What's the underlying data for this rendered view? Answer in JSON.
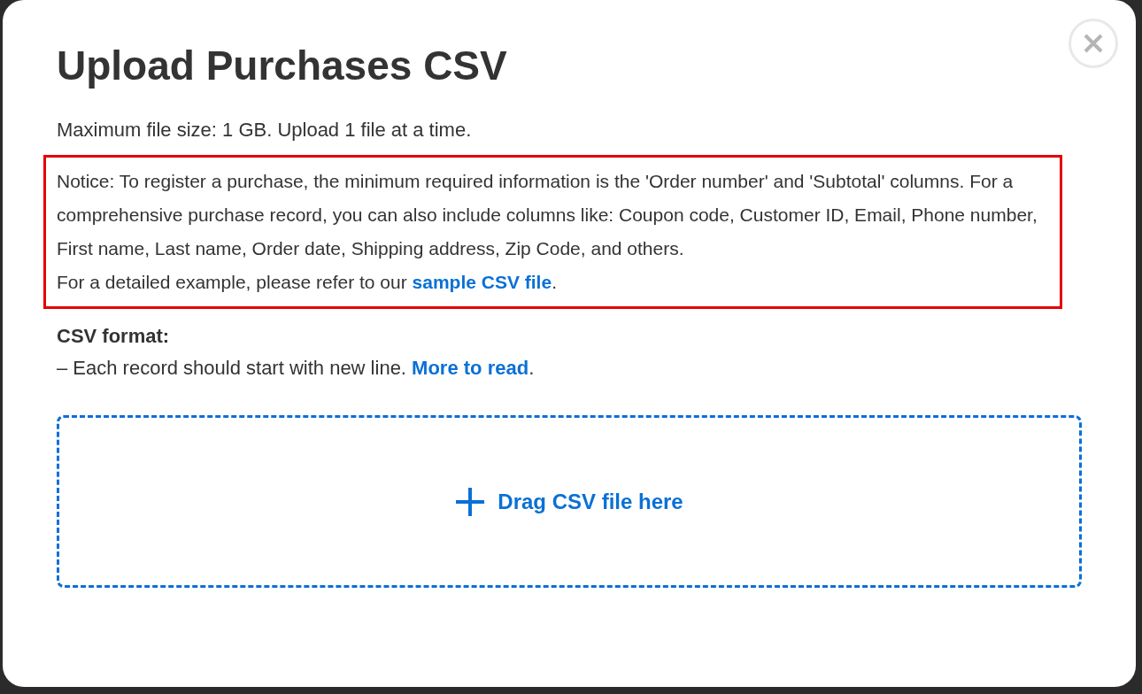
{
  "dialog": {
    "title": "Upload Purchases CSV",
    "info": "Maximum file size: 1 GB. Upload 1 file at a time.",
    "notice": {
      "text": "Notice: To register a purchase, the minimum required information is the 'Order number' and 'Subtotal' columns. For a comprehensive purchase record, you can also include columns like: Coupon code, Customer ID, Email, Phone number, First name, Last name, Order date, Shipping address, Zip Code, and others.",
      "example": {
        "before": "For a detailed example, please refer to our ",
        "link": "sample CSV file",
        "after": "."
      }
    },
    "format": {
      "heading": "CSV format:",
      "line": {
        "before": "– Each record should start with new line. ",
        "link": "More to read",
        "after": "."
      }
    },
    "dropzone": {
      "label": "Drag CSV file here"
    }
  }
}
